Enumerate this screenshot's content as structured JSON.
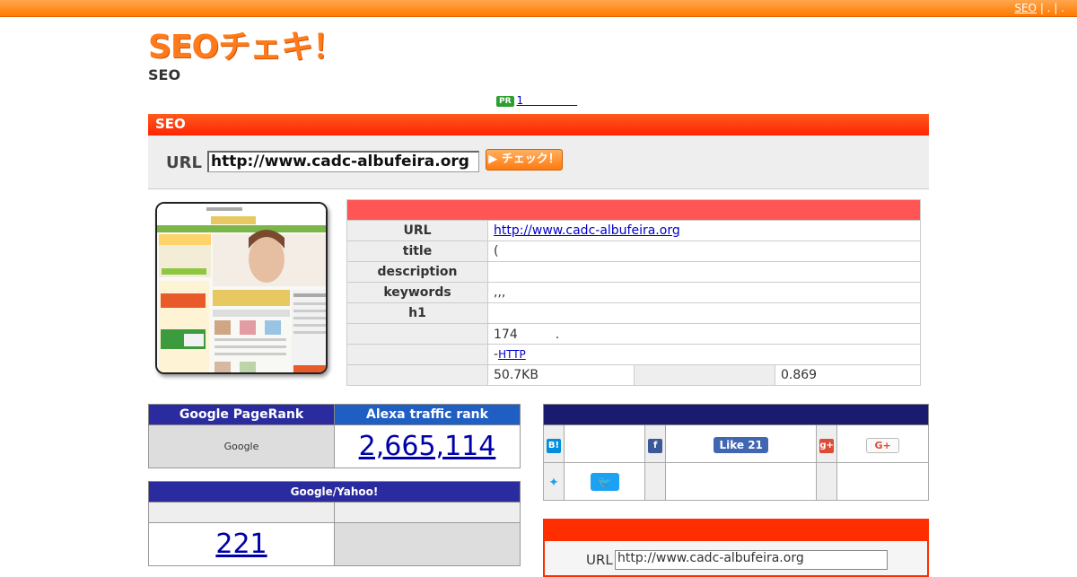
{
  "topbar": {
    "link": "SEO",
    "separators": "| . | ."
  },
  "logo": {
    "text": "SEOチェキ！",
    "subtitle": "SEO"
  },
  "pr": {
    "badge": "PR",
    "link": "1"
  },
  "seo_header": {
    "title": "SEO"
  },
  "url_form": {
    "label": "URL",
    "value": "http://www.cadc-albufeira.org",
    "button": "▶ チェック！"
  },
  "site_info": {
    "rows": [
      {
        "key": "URL",
        "value": "http://www.cadc-albufeira.org",
        "is_link": true
      },
      {
        "key": "title",
        "value": "("
      },
      {
        "key": "description",
        "value": ""
      },
      {
        "key": "keywords",
        "value": ",,,"
      },
      {
        "key": "h1",
        "value": ""
      },
      {
        "key": "",
        "value": "174　　　."
      },
      {
        "key": "",
        "value_prefix": "-",
        "value_link": "HTTP"
      },
      {
        "key": "",
        "value": "50.7KB",
        "extra_value": "0.869"
      }
    ]
  },
  "ranks": {
    "pagerank_header": "Google PageRank",
    "alexa_header": "Alexa traffic rank",
    "pagerank_value": "Google",
    "alexa_value": "2,665,114"
  },
  "google_yahoo": {
    "header": "Google/Yahoo!",
    "google_value": "221",
    "yahoo_value": ""
  },
  "social": {
    "hatena_icon_label": "B!",
    "facebook_like": "Like 21",
    "gplus_label": "G+",
    "twitter_button": "🐦"
  },
  "bottom_form": {
    "label": "URL",
    "value": "http://www.cadc-albufeira.org"
  },
  "colors": {
    "orange": "#ff7a00",
    "red": "#ff2400",
    "navy": "#2b2ba0"
  }
}
